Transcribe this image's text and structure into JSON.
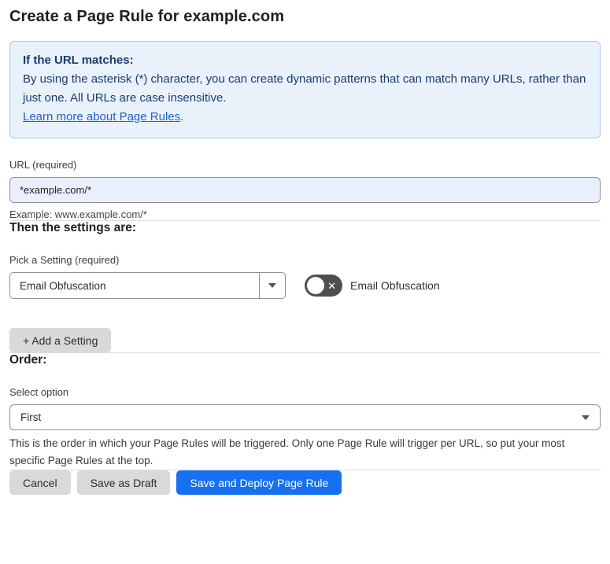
{
  "page": {
    "title": "Create a Page Rule for example.com"
  },
  "info_box": {
    "heading": "If the URL matches:",
    "body": "By using the asterisk (*) character, you can create dynamic patterns that can match many URLs, rather than just one. All URLs are case insensitive.",
    "link_label": "Learn more about Page Rules",
    "link_suffix": "."
  },
  "url_field": {
    "label": "URL (required)",
    "value": "*example.com/*",
    "helper": "Example: www.example.com/*"
  },
  "settings_section": {
    "heading": "Then the settings are:",
    "picker_label": "Pick a Setting (required)",
    "picker_value": "Email Obfuscation",
    "toggle_label": "Email Obfuscation",
    "toggle_state": "off",
    "toggle_off_glyph": "✕",
    "add_setting_label": "+ Add a Setting"
  },
  "order_section": {
    "heading": "Order:",
    "select_label": "Select option",
    "select_value": "First",
    "helper": "This is the order in which your Page Rules will be triggered. Only one Page Rule will trigger per URL, so put your most specific Page Rules at the top."
  },
  "footer": {
    "cancel_label": "Cancel",
    "save_draft_label": "Save as Draft",
    "save_deploy_label": "Save and Deploy Page Rule"
  },
  "colors": {
    "accent_blue": "#1670f0",
    "info_background": "#e9f1fb",
    "info_border": "#abc9e9",
    "info_text": "#1b3c6e",
    "link_blue": "#2161c9",
    "url_input_background": "#e9effc",
    "toggle_off_background": "#4d4f52",
    "gray_button_background": "#d9d9d9"
  }
}
